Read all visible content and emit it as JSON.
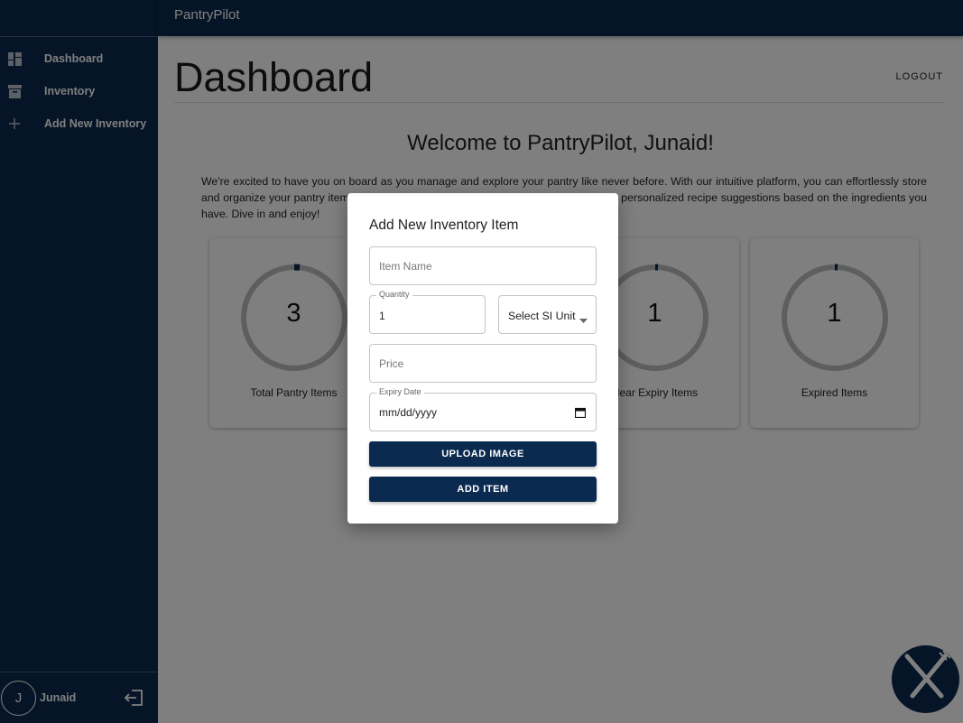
{
  "app": {
    "title": "PantryPilot"
  },
  "sidebar": {
    "items": [
      {
        "label": "Dashboard",
        "icon": "dashboard-icon"
      },
      {
        "label": "Inventory",
        "icon": "archive-icon"
      },
      {
        "label": "Add New Inventory",
        "icon": "plus-icon"
      }
    ],
    "user": {
      "initial": "J",
      "name": "Junaid"
    }
  },
  "header": {
    "page_title": "Dashboard",
    "logout_label": "LOGOUT"
  },
  "welcome": {
    "heading": "Welcome to PantryPilot, Junaid!",
    "paragraph": "We're excited to have you on board as you manage and explore your pantry like never before. With our intuitive platform, you can effortlessly store and organize your pantry items, track expiry dates, and more. Plus, you can now get personalized recipe suggestions based on the ingredients you have. Dive in and enjoy!"
  },
  "stats": [
    {
      "value": "3",
      "label": "Total Pantry Items"
    },
    {
      "value": "",
      "label": ""
    },
    {
      "value": "1",
      "label": "Near Expiry Items"
    },
    {
      "value": "1",
      "label": "Expired Items"
    }
  ],
  "modal": {
    "title": "Add New Inventory Item",
    "item_name_placeholder": "Item Name",
    "quantity_label": "Quantity",
    "quantity_value": "1",
    "unit_select": "Select SI Unit",
    "price_placeholder": "Price",
    "expiry_label": "Expiry Date",
    "expiry_value": "mm/dd/yyyy",
    "upload_label": "UPLOAD IMAGE",
    "add_label": "ADD ITEM"
  },
  "colors": {
    "primary": "#0a2a4f",
    "ring": "#bdbdbd"
  }
}
